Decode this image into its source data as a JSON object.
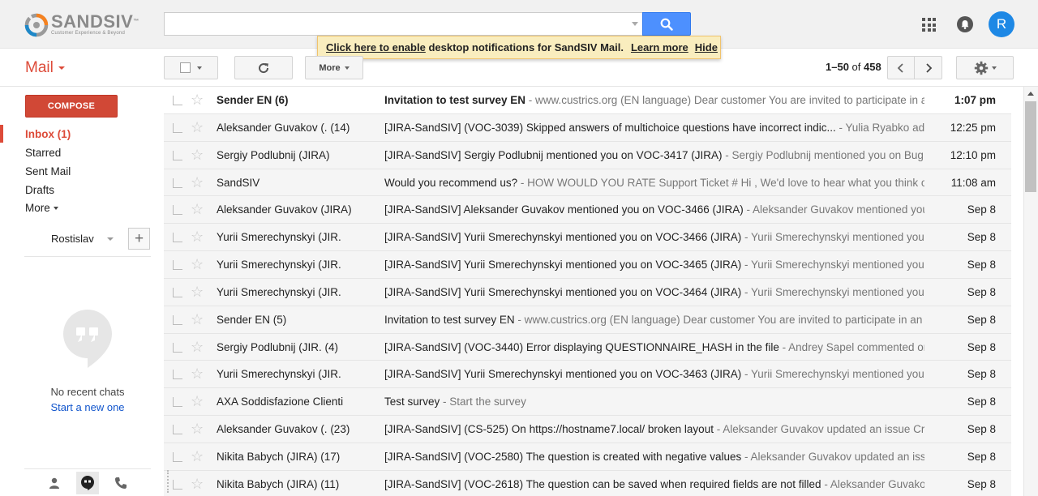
{
  "brand": {
    "name": "SANDSIV",
    "tm": "™",
    "tagline": "Customer Experience & Beyond"
  },
  "search": {
    "placeholder": "",
    "button_icon": "search-icon"
  },
  "header": {
    "apps_icon": "apps-grid-icon",
    "notifications_icon": "bell-icon",
    "avatar_letter": "R",
    "avatar_color": "#1e88e5"
  },
  "notification": {
    "enable_link": "Click here to enable",
    "message": " desktop notifications for SandSIV Mail.",
    "learn_more": "Learn more",
    "hide": "Hide"
  },
  "toolbar": {
    "mail_label": "Mail",
    "more_label": "More",
    "pager_range": "1–50",
    "pager_of": " of ",
    "pager_total": "458"
  },
  "sidebar": {
    "compose_label": "COMPOSE",
    "items": [
      {
        "label": "Inbox (1)",
        "active": true
      },
      {
        "label": "Starred"
      },
      {
        "label": "Sent Mail"
      },
      {
        "label": "Drafts"
      },
      {
        "label": "More"
      }
    ]
  },
  "hangouts": {
    "user": "Rostislav",
    "add_label": "+",
    "no_chats": "No recent chats",
    "start_new": "Start a new one"
  },
  "messages": [
    {
      "sender": "Sender EN (6)",
      "subject": "Invitation to test survey EN",
      "snippet": " - www.custrics.org (EN language) Dear customer You are invited to participate in an online",
      "date": "1:07 pm",
      "unread": true
    },
    {
      "sender": "Aleksander Guvakov (. (14)",
      "subject": "[JIRA-SandSIV] (VOC-3039) Skipped answers of multichoice questions have incorrect indic...",
      "snippet": " - Yulia Ryabko added a",
      "date": "12:25 pm",
      "unread": false
    },
    {
      "sender": "Sergiy Podlubnij (JIRA)",
      "subject": "[JIRA-SandSIV] Sergiy Podlubnij mentioned you on VOC-3417 (JIRA)",
      "snippet": " - Sergiy Podlubnij mentioned you on Bug VOC-",
      "date": "12:10 pm",
      "unread": false
    },
    {
      "sender": "SandSIV",
      "subject": "Would you recommend us?",
      "snippet": " - HOW WOULD YOU RATE Support Ticket # Hi , We'd love to hear what you think of our c",
      "date": "11:08 am",
      "unread": false
    },
    {
      "sender": "Aleksander Guvakov (JIRA)",
      "subject": "[JIRA-SandSIV] Aleksander Guvakov mentioned you on VOC-3466 (JIRA)",
      "snippet": " - Aleksander Guvakov mentioned you on B",
      "date": "Sep 8",
      "unread": false
    },
    {
      "sender": "Yurii Smerechynskyi (JIR.",
      "subject": "[JIRA-SandSIV] Yurii Smerechynskyi mentioned you on VOC-3466 (JIRA)",
      "snippet": " - Yurii Smerechynskyi mentioned you on Bu",
      "date": "Sep 8",
      "unread": false
    },
    {
      "sender": "Yurii Smerechynskyi (JIR.",
      "subject": "[JIRA-SandSIV] Yurii Smerechynskyi mentioned you on VOC-3465 (JIRA)",
      "snippet": " - Yurii Smerechynskyi mentioned you on Bu",
      "date": "Sep 8",
      "unread": false
    },
    {
      "sender": "Yurii Smerechynskyi (JIR.",
      "subject": "[JIRA-SandSIV] Yurii Smerechynskyi mentioned you on VOC-3464 (JIRA)",
      "snippet": " - Yurii Smerechynskyi mentioned you on Bu",
      "date": "Sep 8",
      "unread": false
    },
    {
      "sender": "Sender EN (5)",
      "subject": "Invitation to test survey EN",
      "snippet": " - www.custrics.org (EN language) Dear customer You are invited to participate in an online",
      "date": "Sep 8",
      "unread": false
    },
    {
      "sender": "Sergiy Podlubnij (JIR. (4)",
      "subject": "[JIRA-SandSIV] (VOC-3440) Error displaying QUESTIONNAIRE_HASH in the file",
      "snippet": " - Andrey Sapel commented on Bug",
      "date": "Sep 8",
      "unread": false
    },
    {
      "sender": "Yurii Smerechynskyi (JIR.",
      "subject": "[JIRA-SandSIV] Yurii Smerechynskyi mentioned you on VOC-3463 (JIRA)",
      "snippet": " - Yurii Smerechynskyi mentioned you on Bu",
      "date": "Sep 8",
      "unread": false
    },
    {
      "sender": "AXA Soddisfazione Clienti",
      "subject": "Test survey",
      "snippet": " - Start the survey",
      "date": "Sep 8",
      "unread": false
    },
    {
      "sender": "Aleksander Guvakov (. (23)",
      "subject": "[JIRA-SandSIV] (CS-525) On https://hostname7.local/ broken layout",
      "snippet": " - Aleksander Guvakov updated an issue Credit S",
      "date": "Sep 8",
      "unread": false
    },
    {
      "sender": "Nikita Babych (JIRA) (17)",
      "subject": "[JIRA-SandSIV] (VOC-2580) The question is created with negative values",
      "snippet": " - Aleksander Guvakov updated an issue Vo",
      "date": "Sep 8",
      "unread": false
    },
    {
      "sender": "Nikita Babych (JIRA) (11)",
      "subject": "[JIRA-SandSIV] (VOC-2618) The question can be saved when required fields are not filled",
      "snippet": " - Aleksander Guvakov upd",
      "date": "Sep 8",
      "unread": false
    }
  ],
  "colors": {
    "accent_red": "#dd4b39",
    "compose_red": "#d14836",
    "search_blue": "#4d90fe",
    "link_blue": "#15c",
    "notify_bg": "#f9edbe"
  }
}
